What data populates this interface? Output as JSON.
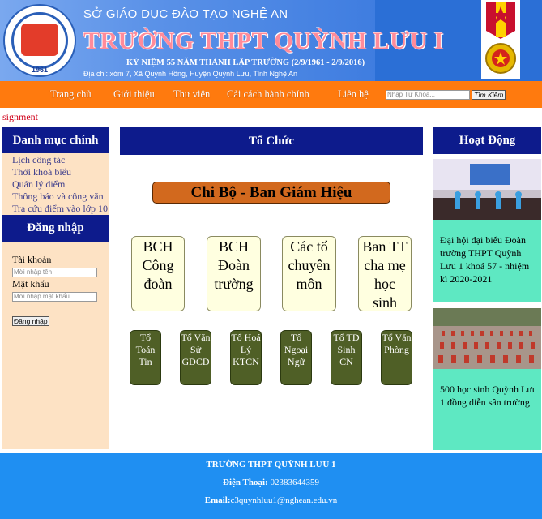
{
  "header": {
    "department": "SỞ GIÁO DỤC ĐÀO TẠO NGHỆ AN",
    "school_name": "TRƯỜNG THPT QUỲNH LƯU I",
    "anniversary": "KỶ NIỆM 55 NĂM THÀNH LẬP TRƯỜNG (2/9/1961 - 2/9/2016)",
    "address": "Địa chỉ: xóm 7, Xã Quỳnh Hồng,  Huyện Quỳnh Lưu, Tỉnh Nghệ An",
    "logo_year": "1961",
    "logo_text": "QUỲNH LƯU I"
  },
  "nav": {
    "items": [
      "Trang chủ",
      "Giới thiệu",
      "Thư viện",
      "Cải cách hành chính",
      "Liên hệ"
    ],
    "search_placeholder": "Nhập Từ Khoá...",
    "search_button": "Tìm Kiếm"
  },
  "assignment_text": "signment",
  "left_sidebar": {
    "menu_title": "Danh mục chính",
    "links": [
      "Lịch công tác",
      "Thời khoá biểu",
      "Quản lý điểm",
      "Thông báo và công văn",
      "Tra cứu điểm vào lớp 10"
    ],
    "login_title": "Đăng nhập",
    "username_label": "Tài khoản",
    "username_placeholder": "Mời nhập tên",
    "password_label": "Mật khẩu",
    "password_placeholder": "Mời nhập mật khẩu",
    "login_button": "Đăng nhập"
  },
  "center": {
    "title": "Tổ Chức",
    "leadership": "Chi Bộ - Ban Giám Hiệu",
    "groups": [
      [
        "BCH",
        "Công",
        "đoàn"
      ],
      [
        "BCH",
        "Đoàn",
        "trường"
      ],
      [
        "Các tổ",
        "chuyên",
        "môn"
      ],
      [
        "Ban TT",
        "cha mẹ",
        "học",
        "sinh"
      ]
    ],
    "departments": [
      [
        "Tổ",
        "Toán",
        "Tin"
      ],
      [
        "Tổ Văn",
        "Sử",
        "GDCD"
      ],
      [
        "Tổ Hoá",
        "Lý",
        "KTCN"
      ],
      [
        "Tổ",
        "Ngoại",
        "Ngữ"
      ],
      [
        "Tổ TD",
        "Sinh",
        "CN"
      ],
      [
        "Tổ Văn",
        "Phòng"
      ]
    ]
  },
  "right_sidebar": {
    "title": "Hoạt Động",
    "news": [
      "Đại hội đại biểu Đoàn trường THPT Quỳnh Lưu 1 khoá 57 - nhiệm kì 2020-2021",
      "500 học sinh Quỳnh Lưu 1 đồng diễn sân trường"
    ]
  },
  "footer": {
    "school": "TRƯỜNG THPT QUỲNH LƯU 1",
    "phone_label": "Điện Thoại:",
    "phone": " 02383644359",
    "email_label": "Email:",
    "email": "c3quynhluu1@nghean.edu.vn"
  },
  "colors": {
    "nav_bg": "#ff7a0e",
    "panel_head": "#0d1b8c",
    "footer_bg": "#1f8ff2",
    "news_bg": "#5ee8c2",
    "left_bg": "#fde2c4"
  }
}
